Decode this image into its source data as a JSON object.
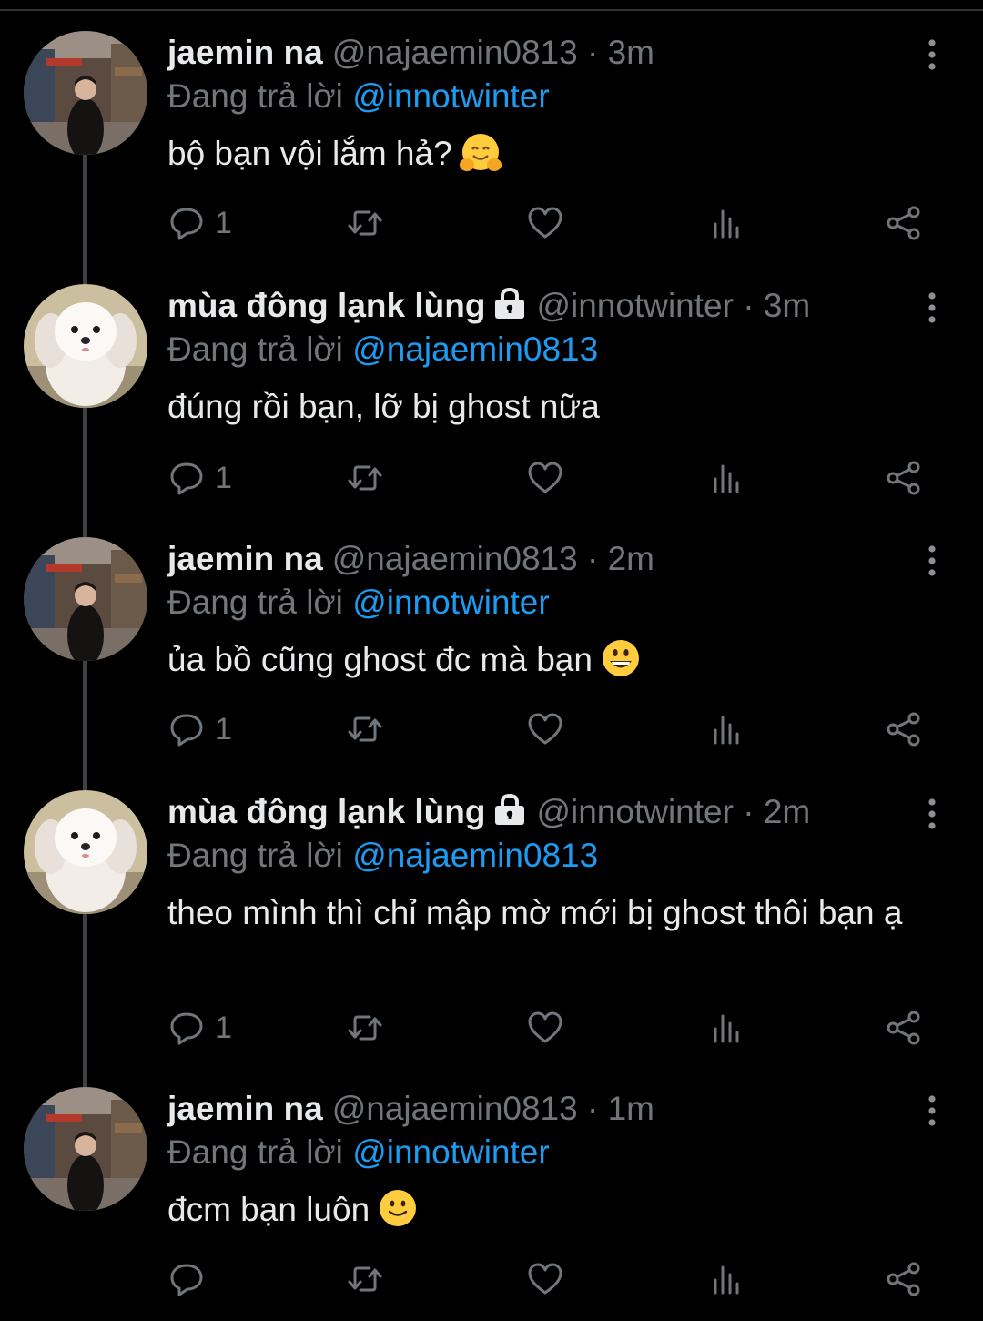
{
  "reply_prefix": "Đang trả lời",
  "tweets": [
    {
      "name": "jaemin na",
      "locked": false,
      "handle": "@najaemin0813",
      "time": "3m",
      "reply_to": "@innotwinter",
      "text": "bộ bạn vội lắm hả?",
      "emoji": "hugging-face-emoji",
      "reply_count": "1",
      "avatar": "street-photo-avatar"
    },
    {
      "name": "mùa đông lạnk lùng",
      "locked": true,
      "handle": "@innotwinter",
      "time": "3m",
      "reply_to": "@najaemin0813",
      "text": "đúng rồi bạn, lỡ bị ghost nữa",
      "emoji": "",
      "reply_count": "1",
      "avatar": "white-puppy-avatar"
    },
    {
      "name": "jaemin na",
      "locked": false,
      "handle": "@najaemin0813",
      "time": "2m",
      "reply_to": "@innotwinter",
      "text": "ủa bồ cũng ghost đc mà bạn",
      "emoji": "grinning-face-emoji",
      "reply_count": "1",
      "avatar": "street-photo-avatar"
    },
    {
      "name": "mùa đông lạnk lùng",
      "locked": true,
      "handle": "@innotwinter",
      "time": "2m",
      "reply_to": "@najaemin0813",
      "text": "theo mình thì chỉ mập mờ mới bị ghost thôi bạn ạ",
      "emoji": "",
      "reply_count": "1",
      "avatar": "white-puppy-avatar"
    },
    {
      "name": "jaemin na",
      "locked": false,
      "handle": "@najaemin0813",
      "time": "1m",
      "reply_to": "@innotwinter",
      "text": "đcm bạn luôn",
      "emoji": "slightly-smiling-face-emoji",
      "reply_count": "",
      "avatar": "street-photo-avatar"
    }
  ],
  "colors": {
    "background": "#000000",
    "text": "#e7e9ea",
    "muted": "#71767b",
    "link": "#1d9bf0",
    "thread_line": "#3e4144"
  }
}
